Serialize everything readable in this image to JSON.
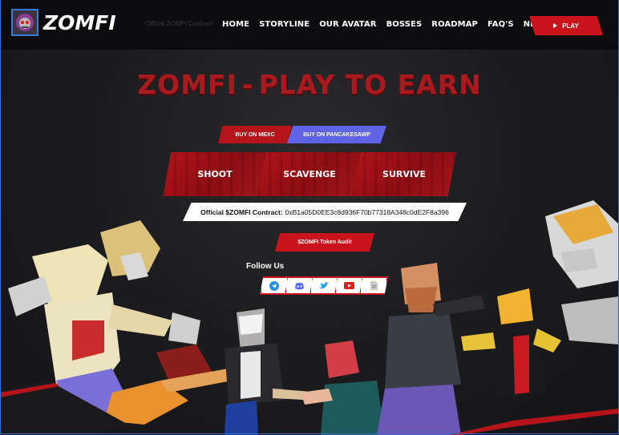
{
  "header": {
    "logo_text": "ZOMFI",
    "tagline": "Official ZOMFI Contract",
    "nav": [
      "HOME",
      "STORYLINE",
      "OUR AVATAR",
      "BOSSES",
      "ROADMAP",
      "FAQ'S",
      "NEWS"
    ],
    "play_label": "PLAY"
  },
  "hero": {
    "title_left": "ZOMFI",
    "title_dash": "-",
    "title_right": "PLAY TO EARN"
  },
  "exchanges": {
    "mexc_label": "BUY ON MEXC",
    "pancake_label": "BUY ON PANCAKESAWP"
  },
  "actions": [
    "SHOOT",
    "SCAVENGE",
    "SURVIVE"
  ],
  "contract": {
    "label": "Official $ZOMFI Contract:",
    "address": "0xB1a05D0EE3c8d936F70b77318A348c0dE2F8a396"
  },
  "audit_label": "$ZOMFI Token Audit",
  "follow": {
    "label": "Follow Us",
    "icons": [
      "telegram-icon",
      "discord-icon",
      "twitter-icon",
      "youtube-icon",
      "document-icon"
    ]
  },
  "colors": {
    "accent": "#c8141a",
    "pancake": "#5f63e6",
    "background": "#1d1d20"
  }
}
